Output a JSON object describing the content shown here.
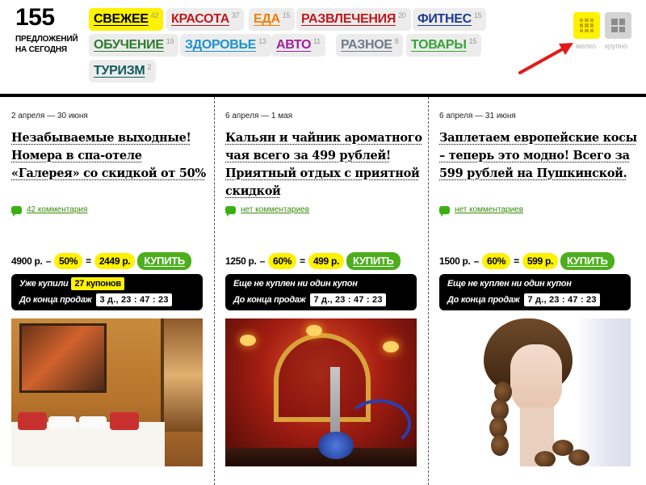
{
  "header": {
    "deal_count": "155",
    "deal_count_caption_line1": "ПРЕДЛОЖЕНИЙ",
    "deal_count_caption_line2": "НА СЕГОДНЯ",
    "categories": [
      {
        "label": "СВЕЖЕЕ",
        "count": "42",
        "color": "#000000",
        "active": true
      },
      {
        "label": "КРАСОТА",
        "count": "37",
        "color": "#c0181b"
      },
      {
        "label": "ЕДА",
        "count": "15",
        "color": "#f07f00"
      },
      {
        "label": "РАЗВЛЕЧЕНИЯ",
        "count": "20",
        "color": "#c0181b"
      },
      {
        "label": "ФИТНЕС",
        "count": "15",
        "color": "#1d3d8c"
      },
      {
        "label": "ОБУЧЕНИЕ",
        "count": "19",
        "color": "#2e7a2e"
      },
      {
        "label": "ЗДОРОВЬЕ",
        "count": "13",
        "color": "#1c92d2"
      },
      {
        "label": "АВТО",
        "count": "11",
        "color": "#a0209e"
      },
      {
        "label": "РАЗНОЕ",
        "count": "8",
        "color": "#6f7b8a"
      },
      {
        "label": "ТОВАРЫ",
        "count": "15",
        "color": "#36a336"
      },
      {
        "label": "ТУРИЗМ",
        "count": "2",
        "color": "#0f5a5a"
      }
    ],
    "view_small_label": "мелко",
    "view_large_label": "крупно",
    "accent_yellow": "#fff200",
    "arrow_color": "#e21a1a"
  },
  "deals": [
    {
      "date": "2 апреля — 30 июня",
      "title": "Незабываемые выходные! Номера в спа-отеле «Галерея» со скидкой от 50%",
      "comments": "42 комментария",
      "price_old": "4900 р.",
      "dash": "–",
      "discount": "50%",
      "equals": "=",
      "price_new": "2449 р.",
      "buy_label": "КУПИТЬ",
      "status_text": "Уже купили",
      "status_badge": "27 купонов",
      "ends_label": "До конца продаж",
      "timer": "3 д., 23 : 47 : 23"
    },
    {
      "date": "6 апреля — 1 мая",
      "title": "Кальян и чайник ароматного чая всего за 499 рублей! Приятный отдых с приятной скидкой",
      "comments": "нет комментариев",
      "price_old": "1250 р.",
      "dash": "–",
      "discount": "60%",
      "equals": "=",
      "price_new": "499 р.",
      "buy_label": "КУПИТЬ",
      "status_text": "Еще не куплен ни один купон",
      "ends_label": "До конца продаж",
      "timer": "7 д., 23 : 47 : 23"
    },
    {
      "date": "6 апреля — 31 июня",
      "title": "Заплетаем европейские косы – теперь это модно! Всего за 599 рублей на Пушкинской.",
      "comments": "нет комментариев",
      "price_old": "1500 р.",
      "dash": "–",
      "discount": "60%",
      "equals": "=",
      "price_new": "599 р.",
      "buy_label": "КУПИТЬ",
      "status_text": "Еще не куплен ни один купон",
      "ends_label": "До конца продаж",
      "timer": "7 д., 23 : 47 : 23"
    }
  ]
}
